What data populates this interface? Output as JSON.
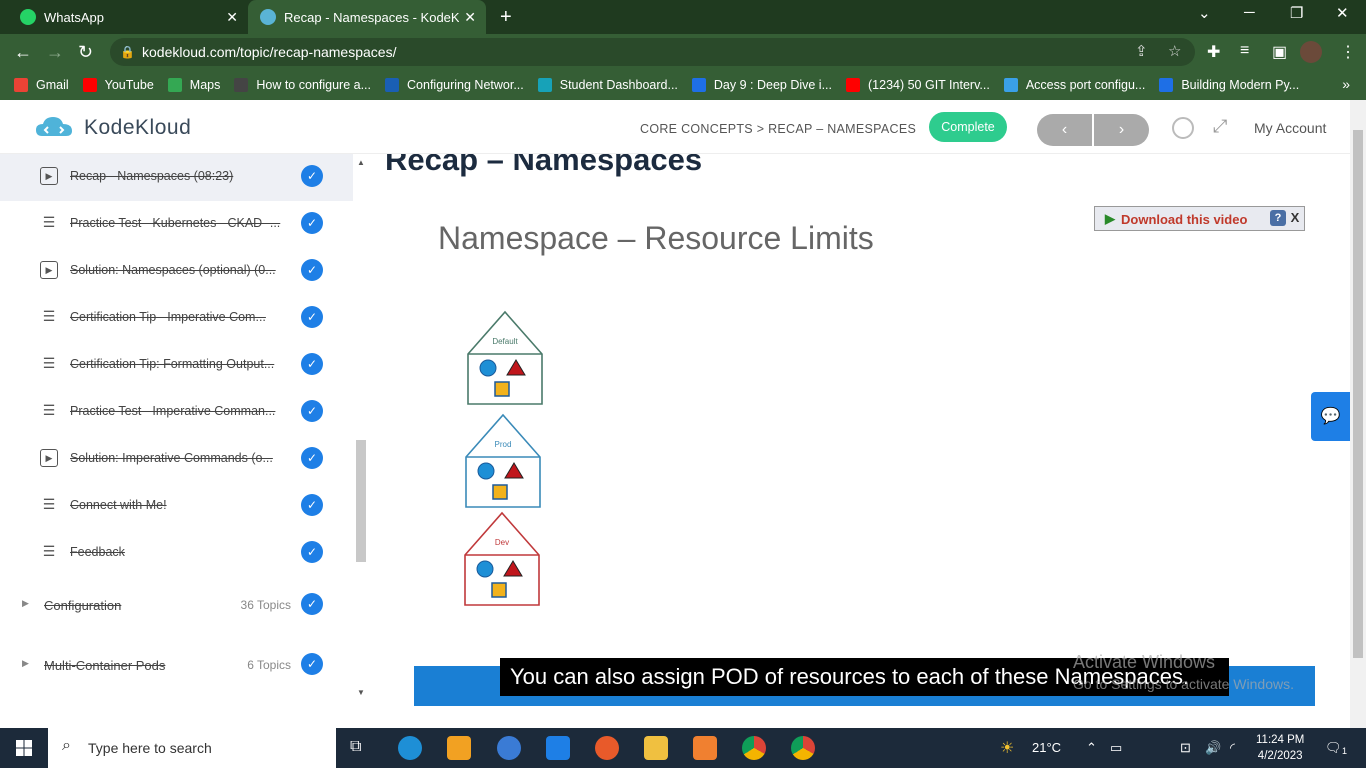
{
  "browser": {
    "tabs": [
      {
        "title": "WhatsApp",
        "close": "✕"
      },
      {
        "title": "Recap - Namespaces - KodeKlou",
        "close": "✕"
      }
    ],
    "new_tab": "+",
    "url": "kodekloud.com/topic/recap-namespaces/",
    "bookmarks": [
      {
        "label": "Gmail",
        "color": "#ea4335"
      },
      {
        "label": "YouTube",
        "color": "#ff0000"
      },
      {
        "label": "Maps",
        "color": "#34a853"
      },
      {
        "label": "How to configure a...",
        "color": "#444444"
      },
      {
        "label": "Configuring Networ...",
        "color": "#1a5fb4"
      },
      {
        "label": "Student Dashboard...",
        "color": "#17a2b8"
      },
      {
        "label": "Day 9 : Deep Dive i...",
        "color": "#1e6fe6"
      },
      {
        "label": "(1234) 50 GIT Interv...",
        "color": "#ff0000"
      },
      {
        "label": "Access port configu...",
        "color": "#3aa0e8"
      },
      {
        "label": "Building Modern Py...",
        "color": "#1e6fe6"
      }
    ],
    "bookmarks_more": "»"
  },
  "site": {
    "logo_text": "KodeKloud",
    "breadcrumb": "CORE CONCEPTS > RECAP – NAMESPACES",
    "complete_label": "Complete",
    "prev": "‹",
    "next": "›",
    "my_account": "My Account"
  },
  "sidebar": {
    "lessons": [
      {
        "label": "Recap - Namespaces (08:23)",
        "icon": "play-icon",
        "active": true
      },
      {
        "label": "Practice Test - Kubernetes - CKAD -...",
        "icon": "list-icon"
      },
      {
        "label": "Solution: Namespaces (optional) (0...",
        "icon": "play-icon"
      },
      {
        "label": "Certification Tip - Imperative Com...",
        "icon": "list-icon"
      },
      {
        "label": "Certification Tip: Formatting Output...",
        "icon": "list-icon"
      },
      {
        "label": "Practice Test - Imperative Comman...",
        "icon": "list-icon"
      },
      {
        "label": "Solution: Imperative Commands (o...",
        "icon": "play-icon"
      },
      {
        "label": "Connect with Me!",
        "icon": "list-icon"
      },
      {
        "label": "Feedback",
        "icon": "list-icon"
      }
    ],
    "sections": [
      {
        "label": "Configuration",
        "count": "36 Topics"
      },
      {
        "label": "Multi-Container Pods",
        "count": "6 Topics"
      }
    ],
    "check_glyph": "✓"
  },
  "content": {
    "title": "Recap – Namespaces",
    "slide_title": "Namespace – Resource Limits",
    "houses": [
      {
        "label": "Default",
        "color": "#4a7a6a"
      },
      {
        "label": "Prod",
        "color": "#3a8ab8"
      },
      {
        "label": "Dev",
        "color": "#c0393b"
      }
    ],
    "download_label": "Download this video",
    "download_help": "?",
    "download_close": "X",
    "caption": "You can also assign POD of resources to each of these Namespaces.",
    "watermark_line1": "Activate Windows",
    "watermark_line2": "Go to Settings to activate Windows."
  },
  "taskbar": {
    "search_placeholder": "Type here to search",
    "weather": "21°C",
    "time": "11:24 PM",
    "date": "4/2/2023",
    "notifications": "1"
  }
}
